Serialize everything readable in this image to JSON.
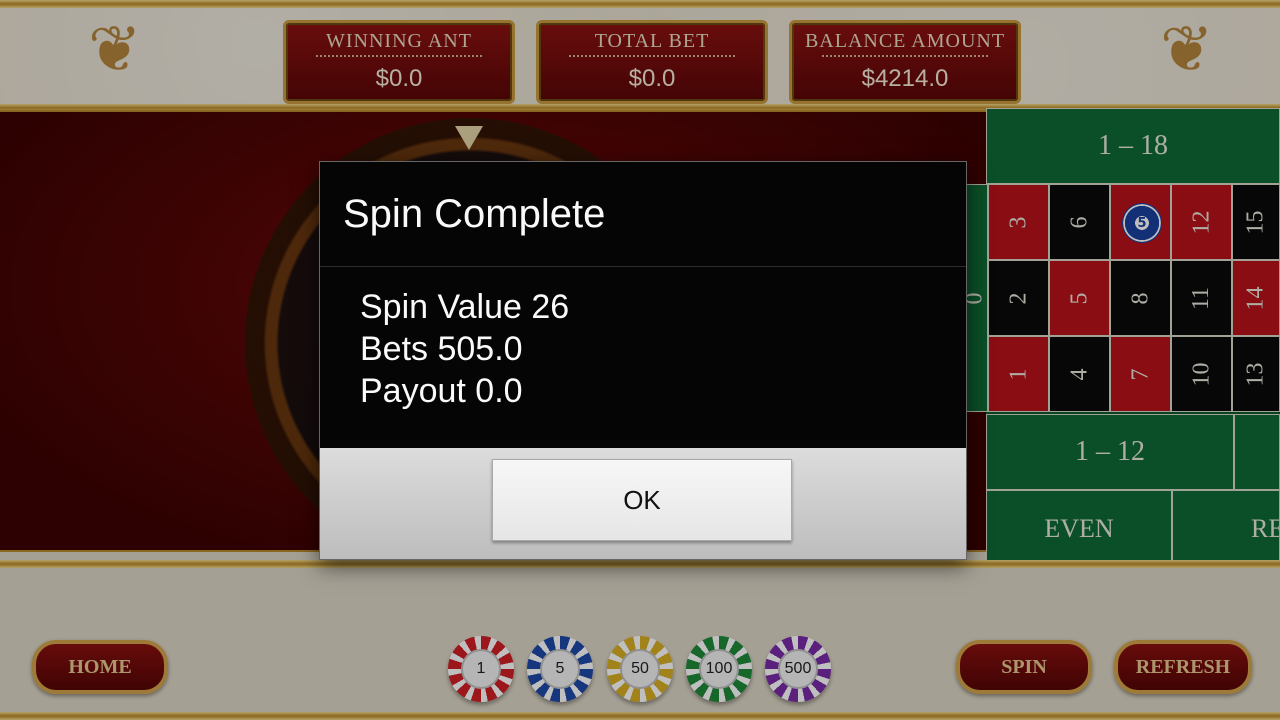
{
  "header": {
    "winning": {
      "label": "WINNING ANT",
      "value": "$0.0"
    },
    "total_bet": {
      "label": "TOTAL BET",
      "value": "$0.0"
    },
    "balance": {
      "label": "BALANCE AMOUNT",
      "value": "$4214.0"
    }
  },
  "board": {
    "range_top": "1 – 18",
    "numbers_row1": [
      "3",
      "6",
      "",
      "12",
      "15"
    ],
    "numbers_row2": [
      "2",
      "5",
      "8",
      "11",
      "14"
    ],
    "numbers_row3": [
      "1",
      "4",
      "7",
      "10",
      "13"
    ],
    "zero": "0",
    "dozen": "1 – 12",
    "even": "EVEN",
    "red": "RED",
    "placed_chip": "5"
  },
  "controls": {
    "home": "HOME",
    "spin": "SPIN",
    "refresh": "REFRESH",
    "chips": [
      {
        "value": "1",
        "color": "#d11f26"
      },
      {
        "value": "5",
        "color": "#1e4aa8"
      },
      {
        "value": "50",
        "color": "#d7ae24"
      },
      {
        "value": "100",
        "color": "#1f8a3a"
      },
      {
        "value": "500",
        "color": "#7a2aa8"
      }
    ]
  },
  "dialog": {
    "title": "Spin Complete",
    "spin_value": "Spin Value 26",
    "bets": "Bets 505.0",
    "payout": "Payout 0.0",
    "ok": "OK"
  }
}
